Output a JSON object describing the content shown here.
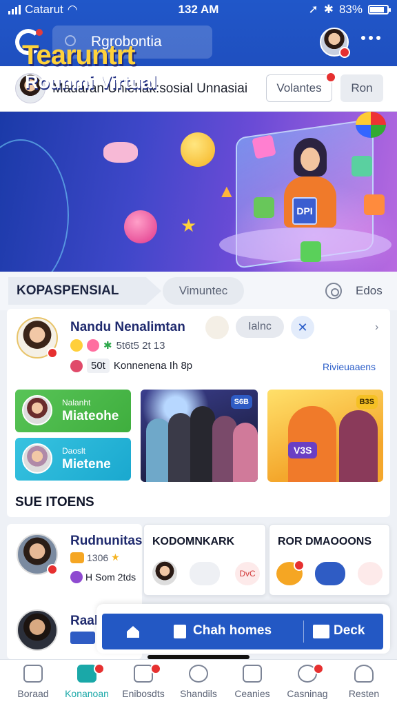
{
  "status_bar": {
    "carrier": "Catarut",
    "time": "132 AM",
    "battery": "83%"
  },
  "header": {
    "search_text": "Rgrobontia"
  },
  "profile_strip": {
    "text": "Madaran Unlehak:sosial Unnasiai",
    "btn_outline": "Volantes",
    "btn_gray": "Ron"
  },
  "banner": {
    "title": "Tearuntrt",
    "subtitle": "Rounmi Virtual",
    "device_label": "DPI"
  },
  "section1": {
    "tab_active": "KOPASPENSIAL",
    "tab_pill": "Vimuntec",
    "edit_label": "Edos",
    "card": {
      "name": "Nandu Nenalimtan",
      "meta": "5t6t5 2t 13",
      "chip": "50t",
      "meta2": "Konnenena Ih 8p",
      "pill": "Ialnc",
      "link": "Rivieuaaens"
    },
    "tiles": [
      {
        "small": "Nalanht",
        "big": "Miateohe"
      },
      {
        "small": "Daoslt",
        "big": "Mietene"
      }
    ],
    "photo1_badge": "S6B",
    "photo2_badge": "B3S",
    "photo2_chip": "V3S"
  },
  "section2": {
    "title": "SUE ITOENS",
    "left_card": {
      "name": "Rudnunitas",
      "meta": "1306",
      "meta2": "H Som 2tds",
      "name2": "Raab"
    },
    "card_k": {
      "title": "KODOMNKARK",
      "icon_label": "DvC"
    },
    "card_d": {
      "title": "ROR DMAOOONS"
    }
  },
  "action_bar": {
    "chat": "Chah homes",
    "deck": "Deck"
  },
  "bottom_nav": [
    {
      "label": "Boraad"
    },
    {
      "label": "Konanoan"
    },
    {
      "label": "Enibosdts"
    },
    {
      "label": "Shandils"
    },
    {
      "label": "Ceanies"
    },
    {
      "label": "Casninag"
    },
    {
      "label": "Resten"
    }
  ]
}
